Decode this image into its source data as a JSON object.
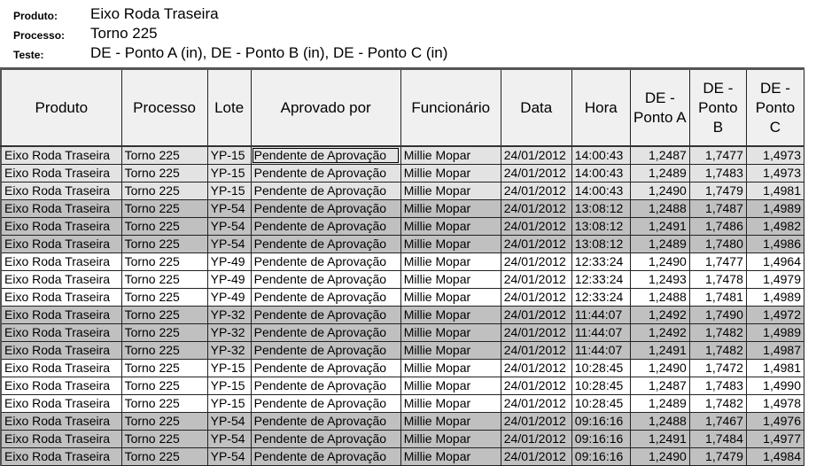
{
  "header": {
    "produto_label": "Produto:",
    "produto_value": "Eixo Roda Traseira",
    "processo_label": "Processo:",
    "processo_value": "Torno 225",
    "teste_label": "Teste:",
    "teste_value": "DE - Ponto A (in), DE - Ponto B (in), DE - Ponto C (in)"
  },
  "table": {
    "columns": [
      {
        "key": "produto",
        "label": "Produto"
      },
      {
        "key": "processo",
        "label": "Processo"
      },
      {
        "key": "lote",
        "label": "Lote"
      },
      {
        "key": "aprovado_por",
        "label": "Aprovado por"
      },
      {
        "key": "funcionario",
        "label": "Funcionário"
      },
      {
        "key": "data",
        "label": "Data"
      },
      {
        "key": "hora",
        "label": "Hora"
      },
      {
        "key": "ponto_a",
        "label": "DE - Ponto A"
      },
      {
        "key": "ponto_b",
        "label": "DE - Ponto B"
      },
      {
        "key": "ponto_c",
        "label": "DE - Ponto C"
      }
    ],
    "row_colors": {
      "light": "#e3e3e3",
      "dark": "#c0c0c0",
      "white": "#ffffff"
    },
    "rows": [
      {
        "group": "light",
        "produto": "Eixo Roda Traseira",
        "processo": "Torno 225",
        "lote": "YP-15",
        "aprovado_por": "Pendente de Aprovação",
        "funcionario": "Millie Mopar",
        "data": "24/01/2012",
        "hora": "14:00:43",
        "ponto_a": "1,2487",
        "ponto_b": "1,7477",
        "ponto_c": "1,4973"
      },
      {
        "group": "light",
        "produto": "Eixo Roda Traseira",
        "processo": "Torno 225",
        "lote": "YP-15",
        "aprovado_por": "Pendente de Aprovação",
        "funcionario": "Millie Mopar",
        "data": "24/01/2012",
        "hora": "14:00:43",
        "ponto_a": "1,2489",
        "ponto_b": "1,7483",
        "ponto_c": "1,4973"
      },
      {
        "group": "light",
        "produto": "Eixo Roda Traseira",
        "processo": "Torno 225",
        "lote": "YP-15",
        "aprovado_por": "Pendente de Aprovação",
        "funcionario": "Millie Mopar",
        "data": "24/01/2012",
        "hora": "14:00:43",
        "ponto_a": "1,2490",
        "ponto_b": "1,7479",
        "ponto_c": "1,4981"
      },
      {
        "group": "dark",
        "produto": "Eixo Roda Traseira",
        "processo": "Torno 225",
        "lote": "YP-54",
        "aprovado_por": "Pendente de Aprovação",
        "funcionario": "Millie Mopar",
        "data": "24/01/2012",
        "hora": "13:08:12",
        "ponto_a": "1,2488",
        "ponto_b": "1,7487",
        "ponto_c": "1,4989"
      },
      {
        "group": "dark",
        "produto": "Eixo Roda Traseira",
        "processo": "Torno 225",
        "lote": "YP-54",
        "aprovado_por": "Pendente de Aprovação",
        "funcionario": "Millie Mopar",
        "data": "24/01/2012",
        "hora": "13:08:12",
        "ponto_a": "1,2491",
        "ponto_b": "1,7486",
        "ponto_c": "1,4982"
      },
      {
        "group": "dark",
        "produto": "Eixo Roda Traseira",
        "processo": "Torno 225",
        "lote": "YP-54",
        "aprovado_por": "Pendente de Aprovação",
        "funcionario": "Millie Mopar",
        "data": "24/01/2012",
        "hora": "13:08:12",
        "ponto_a": "1,2489",
        "ponto_b": "1,7480",
        "ponto_c": "1,4986"
      },
      {
        "group": "white",
        "produto": "Eixo Roda Traseira",
        "processo": "Torno 225",
        "lote": "YP-49",
        "aprovado_por": "Pendente de Aprovação",
        "funcionario": "Millie Mopar",
        "data": "24/01/2012",
        "hora": "12:33:24",
        "ponto_a": "1,2490",
        "ponto_b": "1,7477",
        "ponto_c": "1,4964"
      },
      {
        "group": "white",
        "produto": "Eixo Roda Traseira",
        "processo": "Torno 225",
        "lote": "YP-49",
        "aprovado_por": "Pendente de Aprovação",
        "funcionario": "Millie Mopar",
        "data": "24/01/2012",
        "hora": "12:33:24",
        "ponto_a": "1,2493",
        "ponto_b": "1,7478",
        "ponto_c": "1,4979"
      },
      {
        "group": "white",
        "produto": "Eixo Roda Traseira",
        "processo": "Torno 225",
        "lote": "YP-49",
        "aprovado_por": "Pendente de Aprovação",
        "funcionario": "Millie Mopar",
        "data": "24/01/2012",
        "hora": "12:33:24",
        "ponto_a": "1,2488",
        "ponto_b": "1,7481",
        "ponto_c": "1,4989"
      },
      {
        "group": "dark",
        "produto": "Eixo Roda Traseira",
        "processo": "Torno 225",
        "lote": "YP-32",
        "aprovado_por": "Pendente de Aprovação",
        "funcionario": "Millie Mopar",
        "data": "24/01/2012",
        "hora": "11:44:07",
        "ponto_a": "1,2492",
        "ponto_b": "1,7490",
        "ponto_c": "1,4972"
      },
      {
        "group": "dark",
        "produto": "Eixo Roda Traseira",
        "processo": "Torno 225",
        "lote": "YP-32",
        "aprovado_por": "Pendente de Aprovação",
        "funcionario": "Millie Mopar",
        "data": "24/01/2012",
        "hora": "11:44:07",
        "ponto_a": "1,2492",
        "ponto_b": "1,7482",
        "ponto_c": "1,4989"
      },
      {
        "group": "dark",
        "produto": "Eixo Roda Traseira",
        "processo": "Torno 225",
        "lote": "YP-32",
        "aprovado_por": "Pendente de Aprovação",
        "funcionario": "Millie Mopar",
        "data": "24/01/2012",
        "hora": "11:44:07",
        "ponto_a": "1,2491",
        "ponto_b": "1,7482",
        "ponto_c": "1,4987"
      },
      {
        "group": "white",
        "produto": "Eixo Roda Traseira",
        "processo": "Torno 225",
        "lote": "YP-15",
        "aprovado_por": "Pendente de Aprovação",
        "funcionario": "Millie Mopar",
        "data": "24/01/2012",
        "hora": "10:28:45",
        "ponto_a": "1,2490",
        "ponto_b": "1,7472",
        "ponto_c": "1,4981"
      },
      {
        "group": "white",
        "produto": "Eixo Roda Traseira",
        "processo": "Torno 225",
        "lote": "YP-15",
        "aprovado_por": "Pendente de Aprovação",
        "funcionario": "Millie Mopar",
        "data": "24/01/2012",
        "hora": "10:28:45",
        "ponto_a": "1,2487",
        "ponto_b": "1,7483",
        "ponto_c": "1,4990"
      },
      {
        "group": "white",
        "produto": "Eixo Roda Traseira",
        "processo": "Torno 225",
        "lote": "YP-15",
        "aprovado_por": "Pendente de Aprovação",
        "funcionario": "Millie Mopar",
        "data": "24/01/2012",
        "hora": "10:28:45",
        "ponto_a": "1,2489",
        "ponto_b": "1,7482",
        "ponto_c": "1,4978"
      },
      {
        "group": "dark",
        "produto": "Eixo Roda Traseira",
        "processo": "Torno 225",
        "lote": "YP-54",
        "aprovado_por": "Pendente de Aprovação",
        "funcionario": "Millie Mopar",
        "data": "24/01/2012",
        "hora": "09:16:16",
        "ponto_a": "1,2488",
        "ponto_b": "1,7467",
        "ponto_c": "1,4976"
      },
      {
        "group": "dark",
        "produto": "Eixo Roda Traseira",
        "processo": "Torno 225",
        "lote": "YP-54",
        "aprovado_por": "Pendente de Aprovação",
        "funcionario": "Millie Mopar",
        "data": "24/01/2012",
        "hora": "09:16:16",
        "ponto_a": "1,2491",
        "ponto_b": "1,7484",
        "ponto_c": "1,4977"
      },
      {
        "group": "dark",
        "produto": "Eixo Roda Traseira",
        "processo": "Torno 225",
        "lote": "YP-54",
        "aprovado_por": "Pendente de Aprovação",
        "funcionario": "Millie Mopar",
        "data": "24/01/2012",
        "hora": "09:16:16",
        "ponto_a": "1,2490",
        "ponto_b": "1,7479",
        "ponto_c": "1,4984"
      }
    ],
    "focused_cell": {
      "row": 0,
      "column": "aprovado_por"
    }
  }
}
